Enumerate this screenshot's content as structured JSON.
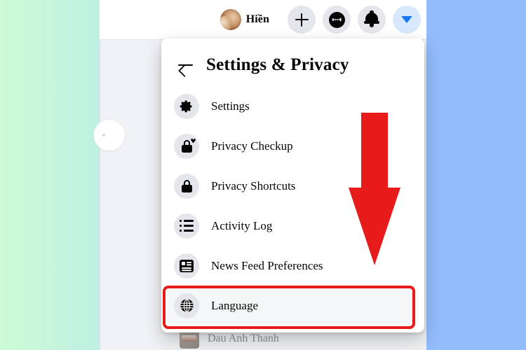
{
  "colors": {
    "accent_blue": "#1877f2",
    "annotation_red": "#e81b1b",
    "panel_bg": "#ffffff",
    "page_bg": "#f0f2f5",
    "icon_bg": "#e4e6eb",
    "left_gradient_from": "#ccfbd6",
    "left_gradient_to": "#bdf0e2",
    "right_panel": "#93bcfb"
  },
  "topbar": {
    "profile_name": "Hiền",
    "avatar_name": "user-avatar",
    "buttons": [
      {
        "name": "create-button",
        "icon": "plus-icon",
        "label": "Create"
      },
      {
        "name": "messenger-button",
        "icon": "messenger-icon",
        "label": "Messenger"
      },
      {
        "name": "notifications-button",
        "icon": "bell-icon",
        "label": "Notifications"
      },
      {
        "name": "account-menu-button",
        "icon": "chevron-down-icon",
        "label": "Account"
      }
    ]
  },
  "dropdown": {
    "back_label": "Back",
    "title": "Settings & Privacy",
    "items": [
      {
        "label": "Settings",
        "icon": "gear-icon",
        "highlighted": false
      },
      {
        "label": "Privacy Checkup",
        "icon": "lock-check-icon",
        "highlighted": false
      },
      {
        "label": "Privacy Shortcuts",
        "icon": "lock-icon",
        "highlighted": false
      },
      {
        "label": "Activity Log",
        "icon": "list-icon",
        "highlighted": false
      },
      {
        "label": "News Feed Preferences",
        "icon": "news-feed-icon",
        "highlighted": false
      },
      {
        "label": "Language",
        "icon": "globe-icon",
        "highlighted": true
      }
    ]
  },
  "annotations": {
    "arrow": {
      "name": "red-down-arrow",
      "direction": "down",
      "color": "#e81b1b"
    },
    "highlight_box": {
      "name": "language-highlight-box",
      "target": "Language",
      "color": "#e81b1b"
    }
  },
  "background_content": {
    "bottom_user_name": "Dau Anh Thanh"
  }
}
